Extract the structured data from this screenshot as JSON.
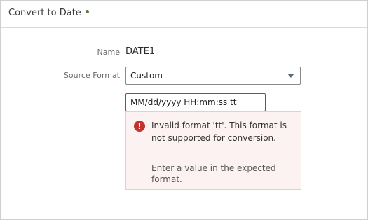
{
  "header": {
    "title": "Convert to Date",
    "status_color": "#5a7a3a"
  },
  "form": {
    "name_label": "Name",
    "name_value": "DATE1",
    "source_format_label": "Source Format",
    "source_format_value": "Custom",
    "format_input_value": "MM/dd/yyyy HH:mm:ss tt"
  },
  "error": {
    "icon": "error-icon",
    "message": "Invalid format 'tt'. This format is not supported for conversion.",
    "help": "Enter a value in the expected format.",
    "color": "#c5312c"
  }
}
